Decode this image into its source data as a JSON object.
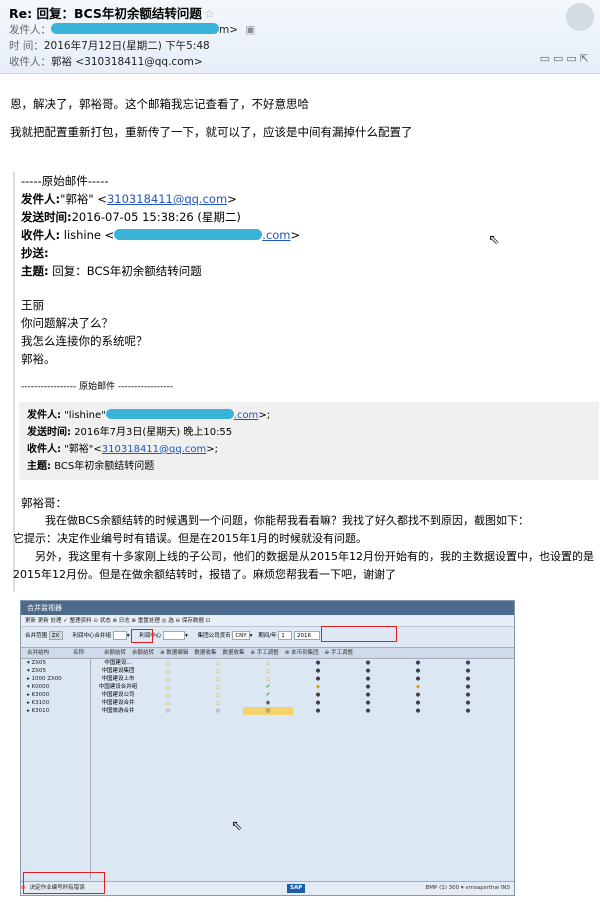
{
  "email": {
    "subject": "Re: 回复：BCS年初余额结转问题",
    "star_icon": "☆",
    "sender_label": "发件人：",
    "sender_suffix": "m>",
    "time_label": "时 间：",
    "time_value": "2016年7月12日(星期二) 下午5:48",
    "recipient_label": "收件人：",
    "recipient_value": "郭裕 <310318411@qq.com>"
  },
  "body": {
    "line1": "恩，解决了，郭裕哥。这个邮箱我忘记查看了，不好意思哈",
    "line2": "我就把配置重新打包，重新传了一下，就可以了，应该是中间有漏掉什么配置了"
  },
  "quote": {
    "separator": "-----原始邮件-----",
    "from_label": "发件人:",
    "from_name": "\"郭裕\" <",
    "from_email": "310318411@qq.com",
    "from_end": ">",
    "sent_label": "发送时间:",
    "sent_value": "2016-07-05 15:38:26 (星期二)",
    "to_label": "收件人:",
    "to_name": "lishine <",
    "to_email_tail": ".com",
    "to_end": ">",
    "cc_label": "抄送:",
    "subject_label": "主题:",
    "subject_value": "回复：BCS年初余额结转问题",
    "msg": [
      "王丽",
      "你问题解决了么？",
      "我怎么连接你的系统呢？",
      "郭裕。"
    ],
    "orig_sep": "----------------- 原始邮件 -----------------",
    "inner_from_label": "发件人:",
    "inner_from_value": "\"lishine\"",
    "inner_from_tail": ".com",
    "inner_from_end": ">;",
    "inner_sent_label": "发送时间:",
    "inner_sent_value": "2016年7月3日(星期天) 晚上10:55",
    "inner_to_label": "收件人:",
    "inner_to_name": "\"郭裕\"<",
    "inner_to_email": "310318411@qq.com",
    "inner_to_end": ">;",
    "inner_subject_label": "主题:",
    "inner_subject_value": "BCS年初余额结转问题",
    "greeting": "郭裕哥：",
    "p1": "我在做BCS余额结转的时候遇到一个问题，你能帮我看看嘛？我找了好久都找不到原因，截图如下：",
    "p2": "它提示：决定作业编号时有错误。但是在2015年1月的时候就没有问题。",
    "p3": "另外，我这里有十多家刚上线的子公司，他们的数据是从2015年12月份开始有的，我的主数据设置中，也设置的是",
    "p4": "2015年12月份。但是在做余额结转时，报错了。麻烦您帮我看一下吧，谢谢了"
  },
  "sap": {
    "title": "合并监视器",
    "toolbar": "更新  更新  处理    ✓ 整理资料   ⊙ 状态   ⊗ 日志   ⊕ 重置处理   ◎ 选   ⊖ 保存数据   ⊡",
    "f1_label": "合并范围",
    "f1_value": "ZX",
    "f2_label": "利润中心合并组",
    "f3_label": "利润中心",
    "f4_label": "集团公司货币",
    "f4_value": "CNY",
    "f5_label": "期间/年",
    "f5_period": "1",
    "f5_year": "2016",
    "cols": [
      "合并结构",
      "名称",
      "余额结转",
      "余额结转",
      "⊕ 数据编辑",
      "数据收集",
      "数据收集",
      "⊕ 手工调整",
      "⊗ 本币到集团",
      "⊕ 手工调整"
    ],
    "tree": [
      "▾ ZX05",
      "  ▾ ZX05",
      "   ▸ 1000 ZX00",
      "   ▾ K0000",
      "     ▸ K3000",
      "     ▸ K3100",
      "     ▸ K3010"
    ],
    "names": [
      "中国建设...",
      "中国建设集团",
      "中国建设上市",
      "中国建设合并组",
      "中国建设公司",
      "中国建设合并",
      "中国旅游合并"
    ],
    "status_msg": "决定作业编号时有错误",
    "logo": "SAP",
    "sys": "BMP (1) 300 ▾  vmsapsrthw  INS"
  },
  "colors": {
    "accent": "#2255bb",
    "blot": "#3ab3d8",
    "error": "#e02020"
  }
}
